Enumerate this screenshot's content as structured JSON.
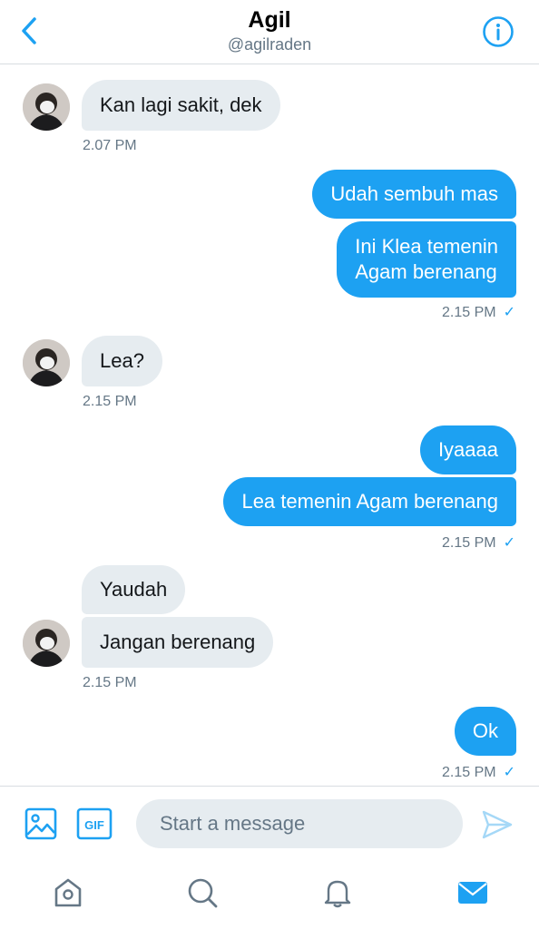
{
  "header": {
    "name": "Agil",
    "handle": "@agilraden"
  },
  "messages": {
    "m1": "Kan lagi sakit, dek",
    "t1": "2.07 PM",
    "m2": "Udah sembuh mas",
    "m3_line1": "Ini Klea temenin",
    "m3_line2": "Agam berenang",
    "t2": "2.15 PM",
    "m4": "Lea?",
    "t3": "2.15 PM",
    "m5": "Iyaaaa",
    "m6": "Lea temenin Agam berenang",
    "t4": "2.15 PM",
    "m7": "Yaudah",
    "m8": "Jangan berenang",
    "t5": "2.15 PM",
    "m9": "Ok",
    "t6": "2.15 PM",
    "read_mark": "✓"
  },
  "composer": {
    "placeholder": "Start a message",
    "gif_label": "GIF"
  },
  "icons": {
    "back": "chevron-left-icon",
    "info": "info-icon",
    "media": "image-icon",
    "gif": "gif-icon",
    "send": "send-icon",
    "home": "home-icon",
    "search": "search-icon",
    "notifications": "bell-icon",
    "messages": "mail-icon"
  },
  "colors": {
    "accent": "#1da1f2",
    "incoming_bubble": "#e6ecf0",
    "secondary_text": "#657786"
  }
}
